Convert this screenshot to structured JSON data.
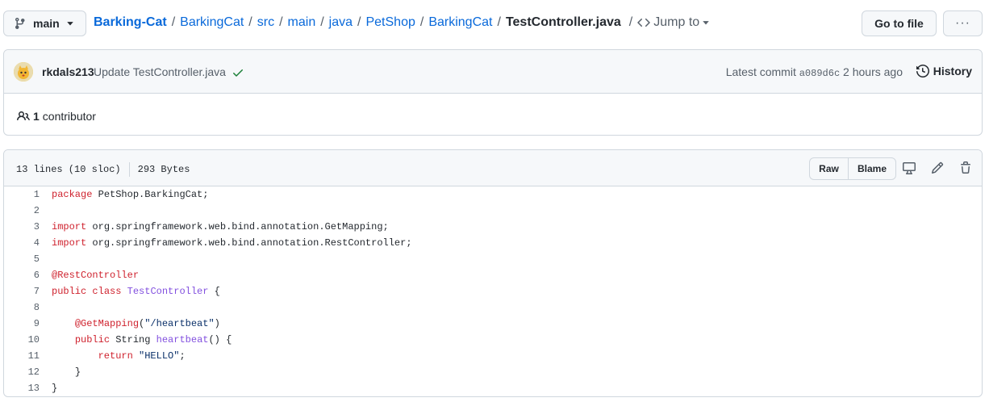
{
  "branch": {
    "name": "main"
  },
  "breadcrumb": {
    "repo": "Barking-Cat",
    "parts": [
      "BarkingCat",
      "src",
      "main",
      "java",
      "PetShop",
      "BarkingCat"
    ],
    "file": "TestController.java",
    "jump_to": "Jump to"
  },
  "header_buttons": {
    "go_to_file": "Go to file",
    "more": "···"
  },
  "commit": {
    "author": "rkdals213",
    "message": "Update TestController.java",
    "latest_label": "Latest commit",
    "sha": "a089d6c",
    "time": "2 hours ago",
    "history_label": "History"
  },
  "contributors": {
    "count": "1",
    "label": "contributor"
  },
  "file": {
    "lines_info": "13 lines (10 sloc)",
    "size": "293 Bytes",
    "raw_label": "Raw",
    "blame_label": "Blame"
  },
  "code_lines": [
    {
      "n": "1",
      "t": "package PetShop.BarkingCat;"
    },
    {
      "n": "2",
      "t": ""
    },
    {
      "n": "3",
      "t": "import org.springframework.web.bind.annotation.GetMapping;"
    },
    {
      "n": "4",
      "t": "import org.springframework.web.bind.annotation.RestController;"
    },
    {
      "n": "5",
      "t": ""
    },
    {
      "n": "6",
      "t": "@RestController"
    },
    {
      "n": "7",
      "t": "public class TestController {"
    },
    {
      "n": "8",
      "t": ""
    },
    {
      "n": "9",
      "t": "    @GetMapping(\"/heartbeat\")"
    },
    {
      "n": "10",
      "t": "    public String heartbeat() {"
    },
    {
      "n": "11",
      "t": "        return \"HELLO\";"
    },
    {
      "n": "12",
      "t": "    }"
    },
    {
      "n": "13",
      "t": "}"
    }
  ],
  "colors": {
    "link": "#0969da",
    "keyword": "#cf222e",
    "class": "#8250df",
    "string": "#0a3069",
    "success": "#1a7f37"
  }
}
